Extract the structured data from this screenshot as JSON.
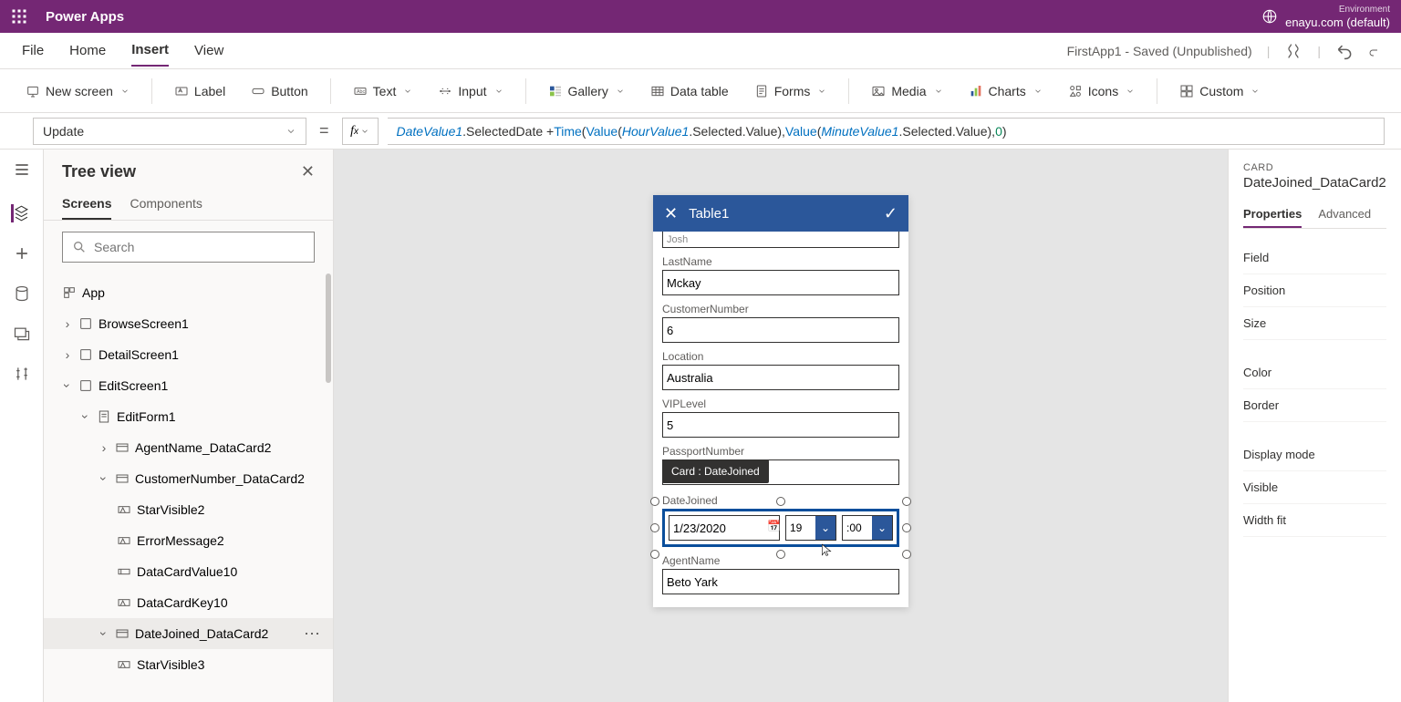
{
  "topbar": {
    "app_title": "Power Apps",
    "env_label": "Environment",
    "env_value": "enayu.com (default)"
  },
  "menubar": {
    "items": [
      "File",
      "Home",
      "Insert",
      "View"
    ],
    "active_index": 2,
    "status": "FirstApp1 - Saved (Unpublished)"
  },
  "ribbon": {
    "new_screen": "New screen",
    "label": "Label",
    "button": "Button",
    "text": "Text",
    "input": "Input",
    "gallery": "Gallery",
    "data_table": "Data table",
    "forms": "Forms",
    "media": "Media",
    "charts": "Charts",
    "icons": "Icons",
    "custom": "Custom"
  },
  "formulabar": {
    "property": "Update",
    "formula_html": "<span class='kw-id'>DateValue1</span><span class='kw-dot'>.SelectedDate + </span><span class='kw-fn'>Time</span><span class='kw-dot'>(</span><span class='kw-fn'>Value</span><span class='kw-dot'>(</span><span class='kw-id'>HourValue1</span><span class='kw-dot'>.Selected.Value), </span><span class='kw-fn'>Value</span><span class='kw-dot'>(</span><span class='kw-id'>MinuteValue1</span><span class='kw-dot'>.Selected.Value), </span><span class='kw-num'>0</span><span class='kw-dot'>)</span>"
  },
  "treepanel": {
    "title": "Tree view",
    "tabs": [
      "Screens",
      "Components"
    ],
    "active_tab": 0,
    "search_placeholder": "Search",
    "nodes": {
      "app": "App",
      "browse": "BrowseScreen1",
      "detail": "DetailScreen1",
      "edit": "EditScreen1",
      "form": "EditForm1",
      "agent_card": "AgentName_DataCard2",
      "cust_card": "CustomerNumber_DataCard2",
      "star2": "StarVisible2",
      "err2": "ErrorMessage2",
      "dcv10": "DataCardValue10",
      "dck10": "DataCardKey10",
      "dj_card": "DateJoined_DataCard2",
      "star3": "StarVisible3"
    }
  },
  "canvas": {
    "form_title": "Table1",
    "tooltip": "Card : DateJoined",
    "fields": {
      "firstname_cut": "Josh",
      "lastname_label": "LastName",
      "lastname": "Mckay",
      "custno_label": "CustomerNumber",
      "custno": "6",
      "loc_label": "Location",
      "loc": "Australia",
      "vip_label": "VIPLevel",
      "vip": "5",
      "passport_label": "PassportNumber",
      "passport": "",
      "dj_label": "DateJoined",
      "dj_date": "1/23/2020",
      "dj_hour": "19",
      "dj_min": ":00",
      "agent_label": "AgentName",
      "agent": "Beto Yark"
    }
  },
  "propspanel": {
    "eyebrow": "CARD",
    "title": "DateJoined_DataCard2",
    "tabs": [
      "Properties",
      "Advanced"
    ],
    "active_tab": 0,
    "rows": [
      "Field",
      "Position",
      "Size",
      "Color",
      "Border",
      "Display mode",
      "Visible",
      "Width fit"
    ]
  }
}
